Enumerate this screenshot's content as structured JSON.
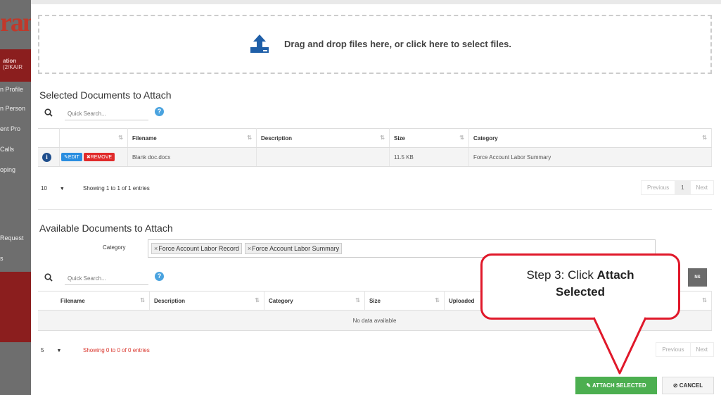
{
  "background_app": {
    "brand_fragment": "ran",
    "redband_line1": "ation",
    "redband_line2": "(2/KAIR",
    "items": [
      "n Profile",
      "n Person",
      "ent Pro",
      "Calls",
      "oping",
      "Request",
      "s"
    ]
  },
  "dropzone": {
    "text": "Drag and drop files here, or click here to select files.",
    "icon": "upload-icon"
  },
  "selected": {
    "title": "Selected Documents to Attach",
    "search_placeholder": "Quick Search...",
    "columns": [
      "Filename",
      "Description",
      "Size",
      "Category"
    ],
    "rows": [
      {
        "edit_label": "EDIT",
        "remove_label": "REMOVE",
        "filename": "Blank doc.docx",
        "description": "",
        "size": "11.5 KB",
        "category": "Force Account Labor Summary"
      }
    ],
    "page_size": "10",
    "entries_text": "Showing 1 to 1 of 1 entries",
    "pager": {
      "previous": "Previous",
      "page": "1",
      "next": "Next"
    }
  },
  "available": {
    "title": "Available Documents to Attach",
    "category_label": "Category",
    "category_chips": [
      "Force Account Labor Record",
      "Force Account Labor Summary"
    ],
    "search_placeholder": "Quick Search...",
    "columns": [
      "Filename",
      "Description",
      "Category",
      "Size",
      "Uploaded"
    ],
    "empty_text": "No data available",
    "page_size": "5",
    "entries_text": "Showing 0 to 0 of 0 entries",
    "pager": {
      "previous": "Previous",
      "next": "Next"
    },
    "columns_button_label": "NS"
  },
  "actions": {
    "attach_label": "ATTACH SELECTED",
    "cancel_label": "CANCEL"
  },
  "callout": {
    "prefix": "Step 3: Click ",
    "bold1": "Attach",
    "bold2": "Selected"
  },
  "colors": {
    "attach_green": "#4caf50",
    "edit_blue": "#2a8ee0",
    "remove_red": "#e02a2a",
    "callout_border": "#e0182a",
    "entries_red": "#d9342b"
  }
}
